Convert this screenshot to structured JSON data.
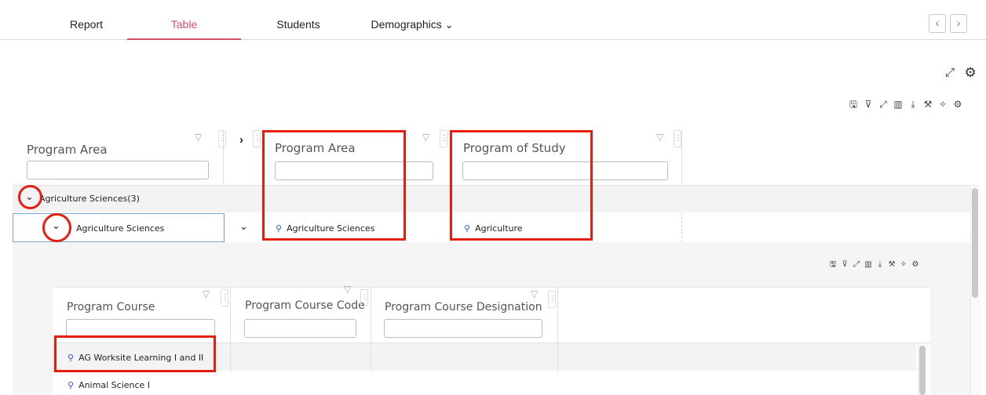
{
  "tabs": [
    {
      "label": "Report"
    },
    {
      "label": "Table"
    },
    {
      "label": "Students"
    },
    {
      "label": "Demographics"
    }
  ],
  "active_tab": "Table",
  "icons": {
    "dropdown": "⌄",
    "prev": "‹",
    "next": "›",
    "expand": "⤢",
    "gear": "⚙",
    "save": "🖫",
    "filter_list": "⊽",
    "columns": "▥",
    "download": "⤓",
    "tools": "⚒",
    "wand": "✧",
    "funnel": "▽",
    "grip": "⋮",
    "chevron_down": "⌄",
    "chevron_right": "›",
    "magnifier": "⚲"
  },
  "accent_color": "#d64f68",
  "highlight_color": "#e61e10",
  "link_icon_color": "#2f55d4",
  "outer_grid": {
    "columns": [
      {
        "header": "Program Area"
      },
      {
        "header": "Program Area"
      },
      {
        "header": "Program of Study"
      }
    ],
    "group_row": {
      "label": "Agriculture Sciences",
      "count": "(3)"
    },
    "sub_group_row": {
      "label": "Agriculture Sciences"
    },
    "data_row": {
      "program_area": "Agriculture Sciences",
      "program_of_study": "Agriculture"
    }
  },
  "inner_grid": {
    "columns": [
      {
        "header": "Program Course"
      },
      {
        "header": "Program Course Code"
      },
      {
        "header": "Program Course Designation"
      }
    ],
    "rows": [
      {
        "course": "AG Worksite Learning I and II"
      },
      {
        "course": "Animal Science I"
      }
    ]
  }
}
